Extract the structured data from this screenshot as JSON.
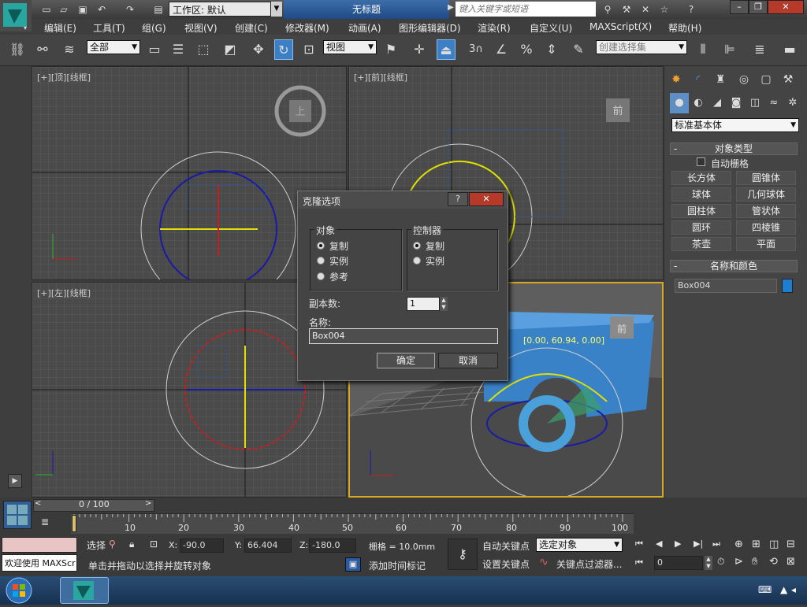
{
  "titlebar": {
    "workspace": "工作区: 默认",
    "title": "无标题",
    "search_placeholder": "键入关键字或短语"
  },
  "menu": [
    "编辑(E)",
    "工具(T)",
    "组(G)",
    "视图(V)",
    "创建(C)",
    "修改器(M)",
    "动画(A)",
    "图形编辑器(D)",
    "渲染(R)",
    "自定义(U)",
    "MAXScript(X)",
    "帮助(H)"
  ],
  "toolbar": {
    "filter": "全部",
    "ref_coord": "视图",
    "snap_num": "3",
    "named_sel_placeholder": "创建选择集"
  },
  "viewports": {
    "top": {
      "p": "[+]",
      "v": "[顶]",
      "s": "[线框]",
      "cube": "上"
    },
    "front": {
      "p": "[+]",
      "v": "[前]",
      "s": "[线框]",
      "cube": "前"
    },
    "left": {
      "p": "[+]",
      "v": "[左]",
      "s": "[线框]"
    },
    "persp": {
      "coord": "[0.00, 60.94, 0.00]",
      "cube": "前"
    }
  },
  "command_panel": {
    "category": "标准基本体",
    "object_type_header": "对象类型",
    "auto_grid": "自动栅格",
    "buttons": [
      "长方体",
      "圆锥体",
      "球体",
      "几何球体",
      "圆柱体",
      "管状体",
      "圆环",
      "四棱锥",
      "茶壶",
      "平面"
    ],
    "name_color_header": "名称和颜色",
    "object_name": "Box004",
    "object_color": "#1e7fd0"
  },
  "dialog": {
    "title": "克隆选项",
    "object_group": "对象",
    "object_options": [
      "复制",
      "实例",
      "参考"
    ],
    "controller_group": "控制器",
    "controller_options": [
      "复制",
      "实例"
    ],
    "copies_label": "副本数:",
    "copies": "1",
    "name_label": "名称:",
    "name": "Box004",
    "ok": "确定",
    "cancel": "取消"
  },
  "timeline": {
    "frame": "0 / 100",
    "ticks": [
      "10",
      "20",
      "30",
      "40",
      "50",
      "60",
      "70",
      "80",
      "90",
      "100"
    ],
    "current": 0,
    "total": 100
  },
  "status": {
    "maxscript": "欢迎使用 MAXScr",
    "mode_label": "选择",
    "x_label": "X:",
    "x": "-90.0",
    "y_label": "Y:",
    "y": "66.404",
    "z_label": "Z:",
    "z": "-180.0",
    "grid": "栅格 = 10.0mm",
    "prompt": "单击并拖动以选择并旋转对象",
    "add_time_tag": "添加时间标记",
    "auto_key": "自动关键点",
    "set_key": "设置关键点",
    "key_mode": "选定对象",
    "key_filters": "关键点过滤器...",
    "frame_value": "0"
  }
}
